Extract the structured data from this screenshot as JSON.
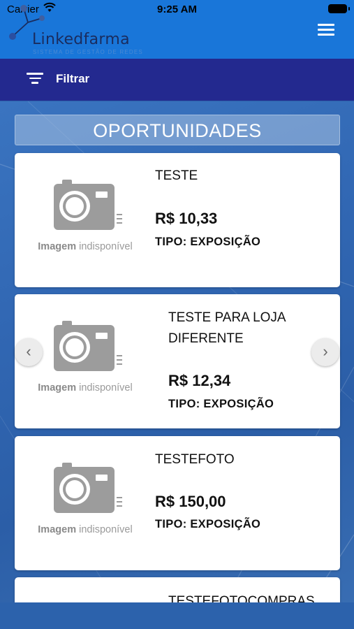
{
  "status_bar": {
    "carrier": "Carrier",
    "time": "9:25 AM"
  },
  "header": {
    "logo_text": "Linkedfarma",
    "logo_subtitle": "SISTEMA DE GESTÃO DE REDES",
    "menu_icon": "hamburger-menu-icon",
    "color": "#1976d9"
  },
  "filter_bar": {
    "label": "Filtrar",
    "icon": "filter-icon",
    "color": "#23298f"
  },
  "section": {
    "title": "OPORTUNIDADES"
  },
  "placeholder": {
    "bold": "Imagem",
    "rest": " indisponível"
  },
  "cards": [
    {
      "title": "TESTE",
      "price": "R$ 10,33",
      "type": "TIPO: EXPOSIÇÃO"
    },
    {
      "title": "TESTE PARA LOJA DIFERENTE",
      "price": "R$ 12,34",
      "type": "TIPO: EXPOSIÇÃO"
    },
    {
      "title": "TESTEFOTO",
      "price": "R$ 150,00",
      "type": "TIPO: EXPOSIÇÃO"
    },
    {
      "title": "TESTEFOTOCOMPRAS"
    }
  ],
  "carousel": {
    "prev_label": "‹",
    "next_label": "›"
  }
}
